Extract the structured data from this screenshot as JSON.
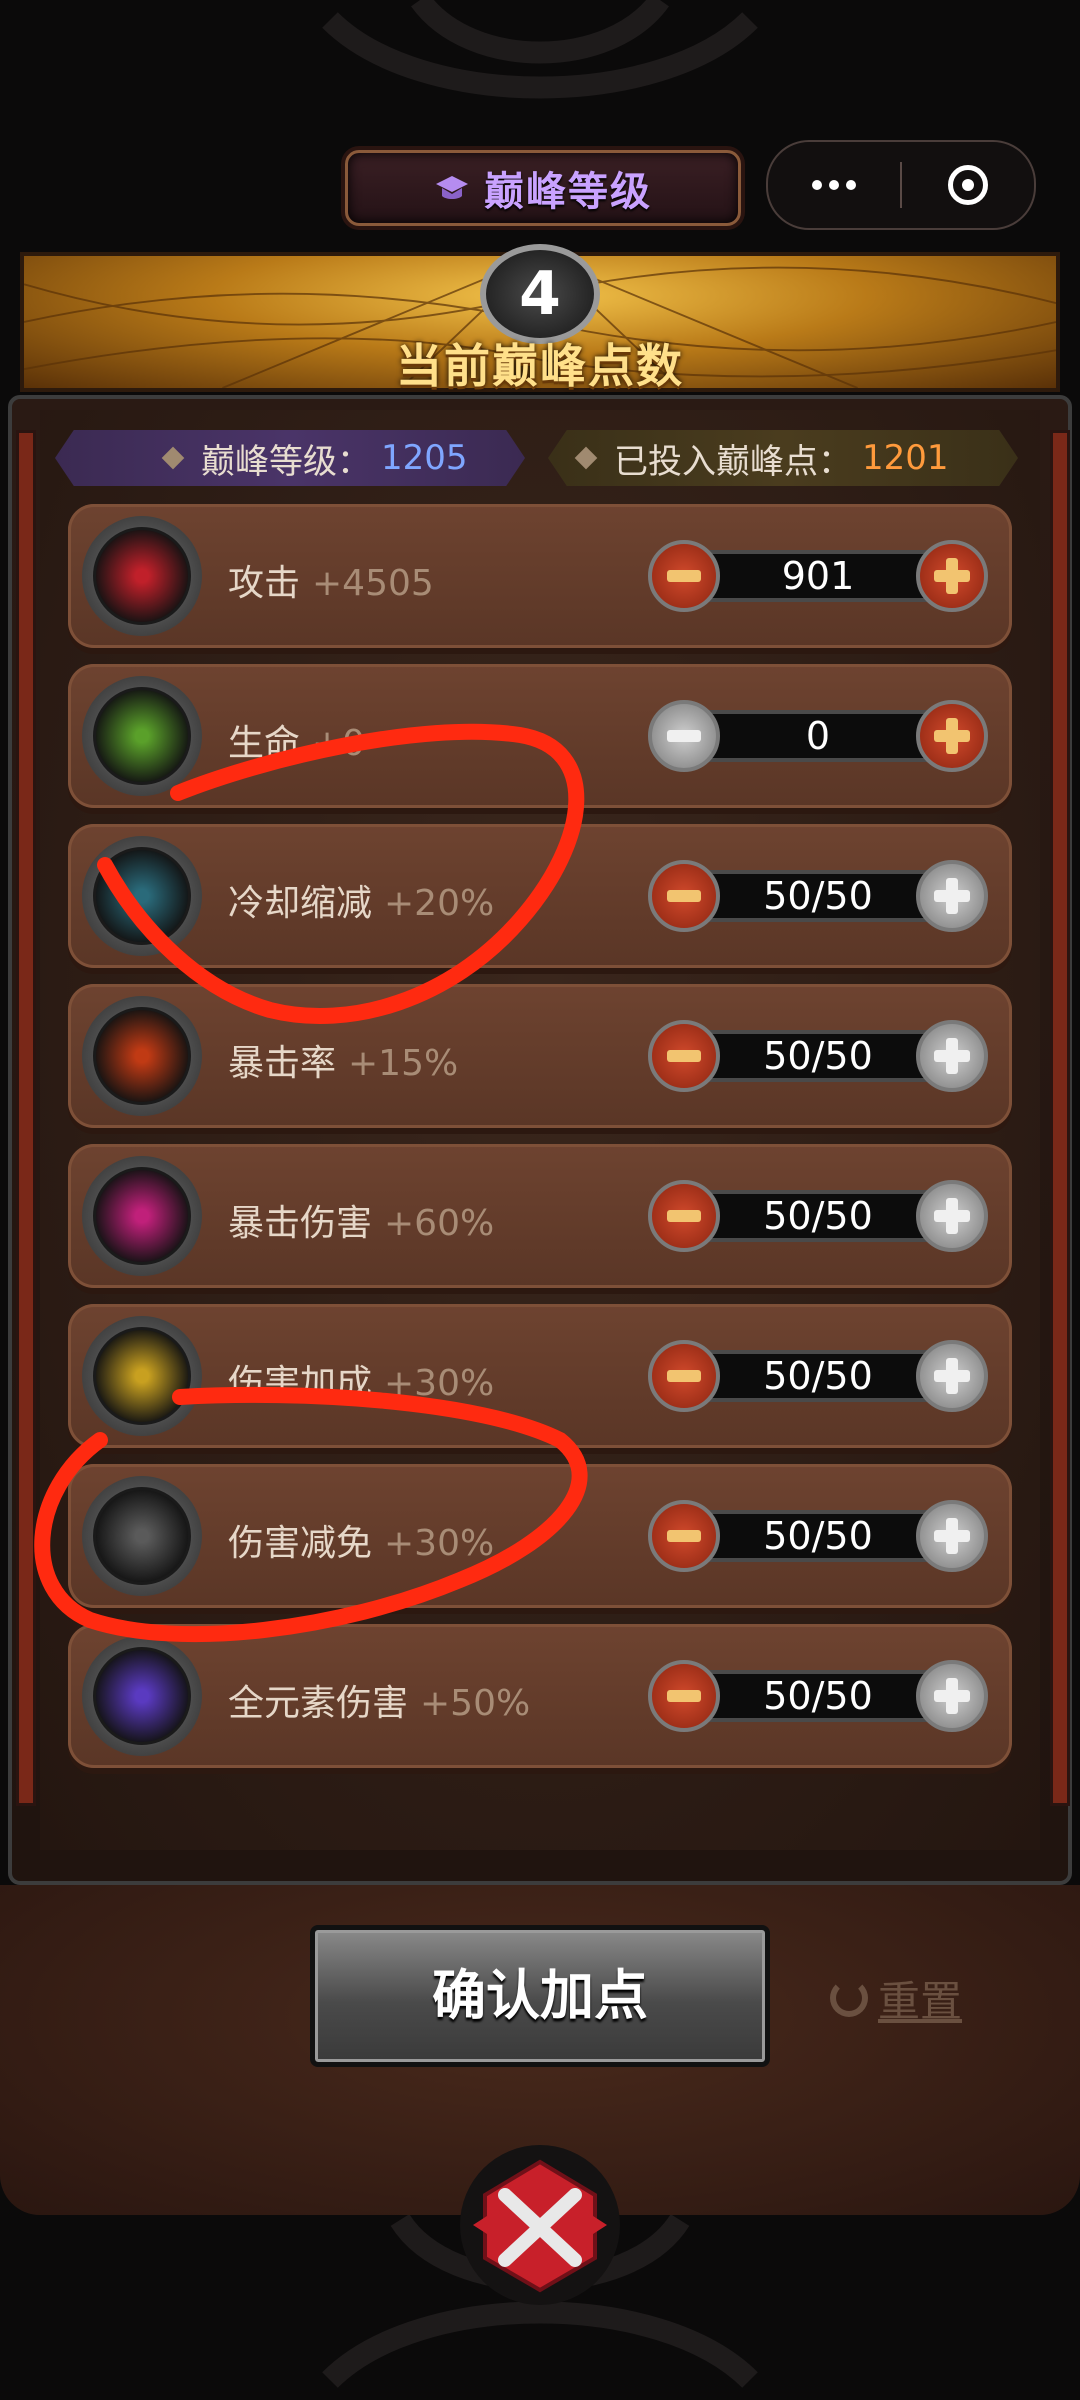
{
  "header": {
    "title": "巅峰等级",
    "miniprogram": {
      "more_icon": "more-dots-icon",
      "close_icon": "target-circle-icon"
    }
  },
  "banner": {
    "points_value": "4",
    "points_label": "当前巅峰点数"
  },
  "stats_ribbon": {
    "level_label": "巅峰等级：",
    "level_value": "1205",
    "invested_label": "已投入巅峰点：",
    "invested_value": "1201"
  },
  "rows": [
    {
      "name": "攻击",
      "bonus": "+4505",
      "value": "901",
      "minus_enabled": true,
      "plus_enabled": true,
      "icon": "attack-target-icon",
      "icon_color": "#c0202a"
    },
    {
      "name": "生命",
      "bonus": "+0",
      "value": "0",
      "minus_enabled": false,
      "plus_enabled": true,
      "icon": "life-orb-icon",
      "icon_color": "#5aa02a"
    },
    {
      "name": "冷却缩减",
      "bonus": "+20%",
      "value": "50/50",
      "minus_enabled": true,
      "plus_enabled": false,
      "icon": "cooldown-icon",
      "icon_color": "#2a6a7a"
    },
    {
      "name": "暴击率",
      "bonus": "+15%",
      "value": "50/50",
      "minus_enabled": true,
      "plus_enabled": false,
      "icon": "crit-rate-flame-icon",
      "icon_color": "#c03a14"
    },
    {
      "name": "暴击伤害",
      "bonus": "+60%",
      "value": "50/50",
      "minus_enabled": true,
      "plus_enabled": false,
      "icon": "crit-damage-arrow-icon",
      "icon_color": "#c0207a"
    },
    {
      "name": "伤害加成",
      "bonus": "+30%",
      "value": "50/50",
      "minus_enabled": true,
      "plus_enabled": false,
      "icon": "damage-bonus-lightning-icon",
      "icon_color": "#c8a020"
    },
    {
      "name": "伤害减免",
      "bonus": "+30%",
      "value": "50/50",
      "minus_enabled": true,
      "plus_enabled": false,
      "icon": "damage-reduction-shield-icon",
      "icon_color": "#5a5a5a"
    },
    {
      "name": "全元素伤害",
      "bonus": "+50%",
      "value": "50/50",
      "minus_enabled": true,
      "plus_enabled": false,
      "icon": "all-element-swirl-icon",
      "icon_color": "#5a3ac0"
    }
  ],
  "actions": {
    "confirm_label": "确认加点",
    "reset_label": "重置"
  },
  "colors": {
    "accent_purple": "#c9a2ff",
    "level_blue": "#7fa6ff",
    "invested_orange": "#ff9a3c",
    "annotation_red": "#ff2a10"
  }
}
